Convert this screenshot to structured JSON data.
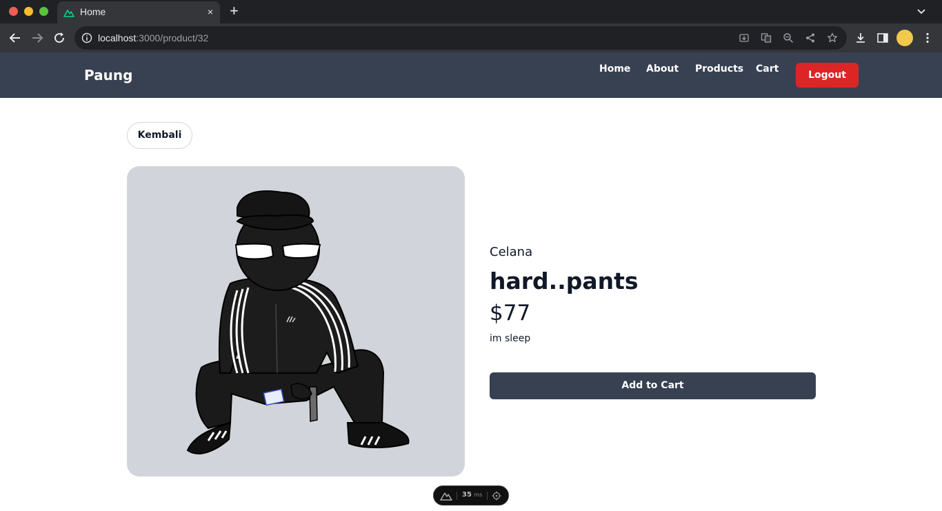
{
  "browser": {
    "tab_title": "Home",
    "tab_close": "×",
    "new_tab": "+",
    "url_host": "localhost",
    "url_path": ":3000/product/32"
  },
  "navbar": {
    "brand": "Paung",
    "links": [
      "Home",
      "About",
      "Products",
      "Cart"
    ],
    "logout_label": "Logout"
  },
  "page": {
    "back_label": "Kembali",
    "product": {
      "category": "Celana",
      "title": "hard..pants",
      "price": "$77",
      "description": "im sleep"
    },
    "add_to_cart_label": "Add to Cart"
  },
  "devtools": {
    "ms_value": "35",
    "ms_unit": "ms"
  },
  "colors": {
    "navbar_bg": "#374151",
    "logout_bg": "#dc2626",
    "image_bg": "#d1d5db",
    "nuxt_green": "#00dc82"
  }
}
